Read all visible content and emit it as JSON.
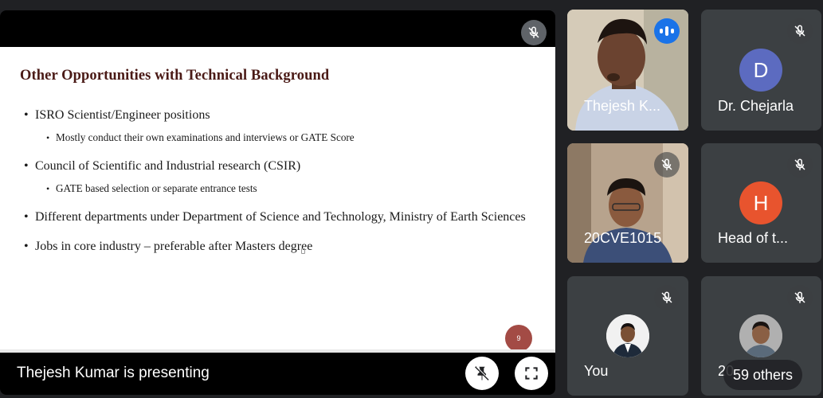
{
  "presentation": {
    "slide": {
      "title": "Other Opportunities with Technical Background",
      "bullets": [
        {
          "text": "ISRO Scientist/Engineer positions",
          "sub": "Mostly conduct their own examinations and interviews or GATE Score"
        },
        {
          "text": "Council of Scientific and Industrial research (CSIR)",
          "sub": "GATE based selection or separate entrance tests"
        },
        {
          "text": "Different departments under Department of Science and Technology, Ministry of Earth Sciences"
        },
        {
          "text": "Jobs in core industry – preferable after Masters degree"
        }
      ],
      "page_number": "9"
    },
    "presenting_label": "Thejesh Kumar is presenting"
  },
  "participants": [
    {
      "name": "Thejesh K...",
      "state": "speaking"
    },
    {
      "name": "Dr. Chejarla",
      "initial": "D",
      "avatar_color": "#5c6bc0",
      "state": "muted"
    },
    {
      "name": "20CVE1015",
      "state": "muted"
    },
    {
      "name": "Head of t...",
      "initial": "H",
      "avatar_color": "#e8542e",
      "state": "muted"
    },
    {
      "name": "You",
      "state": "muted"
    },
    {
      "name": "20...",
      "state": "muted"
    }
  ],
  "others_label": "59 others",
  "colors": {
    "background": "#202124",
    "tile": "#3c4043",
    "speaking": "#1a73e8"
  },
  "icons": {
    "mic_off": "mic-off-icon",
    "speaking": "audio-bars-icon",
    "pin_off": "pin-off-icon",
    "fullscreen": "fullscreen-icon"
  }
}
